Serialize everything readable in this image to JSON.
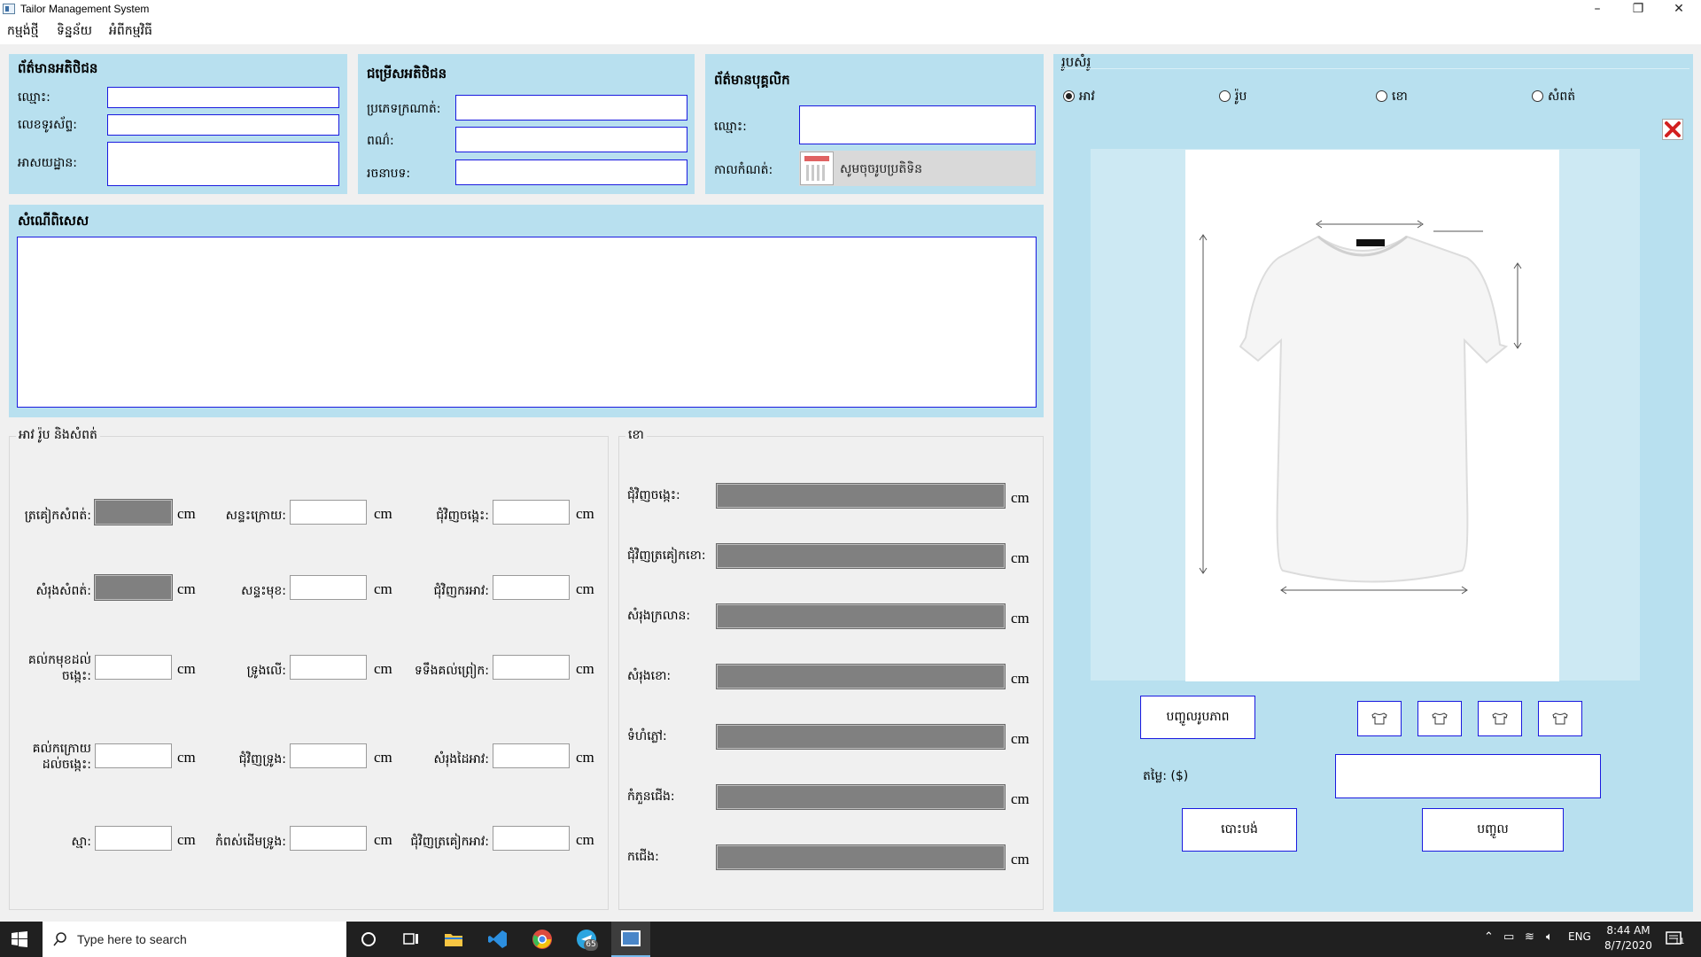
{
  "window": {
    "title": "Tailor Management System",
    "min": "–",
    "max": "❐",
    "close": "✕"
  },
  "menu": [
    "កម្មង់ថ្មី",
    "ទិន្នន័យ",
    "អំពីកម្មវិធី"
  ],
  "customer": {
    "title": "ព័ត៌មានអតិថិជន",
    "name": "ឈ្មោះ:",
    "phone": "លេខទូរស័ព្ទ:",
    "address": "អាសយដ្ឋាន:"
  },
  "choice": {
    "title": "ជម្រើសអតិថិជន",
    "fabric": "ប្រភេទក្រណាត់:",
    "color": "ពណ៌:",
    "style": "រចនាបទ:"
  },
  "staff": {
    "title": "ព័ត៌មានបុគ្គលិក",
    "name": "ឈ្មោះ:",
    "due": "កាលកំណត់:",
    "date_placeholder": "សូមចុចរូបប្រតិទិន"
  },
  "special": {
    "title": "សំណើពិសេស"
  },
  "top_group": {
    "title": "អាវ រ៉ូប និងសំពត់",
    "rows": [
      [
        "ត្រគៀកសំពត់:",
        "សន្ទះក្រោយ:",
        "ជុំវិញចង្កេះ:"
      ],
      [
        "សំរុងសំពត់:",
        "សន្ទះមុខ:",
        "ជុំវិញករអាវ:"
      ],
      [
        "គល់កមុខដល់ចង្កេះ:",
        "ទ្រូងលើ:",
        "ទទឹងគល់ព្រៀក:"
      ],
      [
        "គល់កក្រោយដល់ចង្កេះ:",
        "ជុំវិញទ្រូង:",
        "សំរុងដៃអាវ:"
      ],
      [
        "ស្មា:",
        "កំពស់ដើមទ្រូង:",
        "ជុំវិញត្រគៀកអាវ:"
      ]
    ],
    "unit": "cm"
  },
  "pants_group": {
    "title": "ខោ",
    "fields": [
      "ជុំវិញចង្កេះ:",
      "ជុំវិញត្រគៀកខោ:",
      "សំរុងក្រលាន:",
      "សំរុងខោ:",
      "ទំហំភ្លៅ:",
      "កំភួនជើង:",
      "កជើង:"
    ],
    "unit": "cm"
  },
  "image_panel": {
    "title": "រូបសំរូ",
    "radios": [
      "អាវ",
      "រ៉ូប",
      "ខោ",
      "សំពត់"
    ],
    "insert_image": "បញ្ចូលរូបភាព",
    "price": "តម្លៃ: ($)",
    "cancel": "បោះបង់",
    "save": "បញ្ចូល"
  },
  "taskbar": {
    "search": "Type here to search",
    "lang": "ENG",
    "time": "8:44 AM",
    "date": "8/7/2020",
    "badge": "11"
  }
}
